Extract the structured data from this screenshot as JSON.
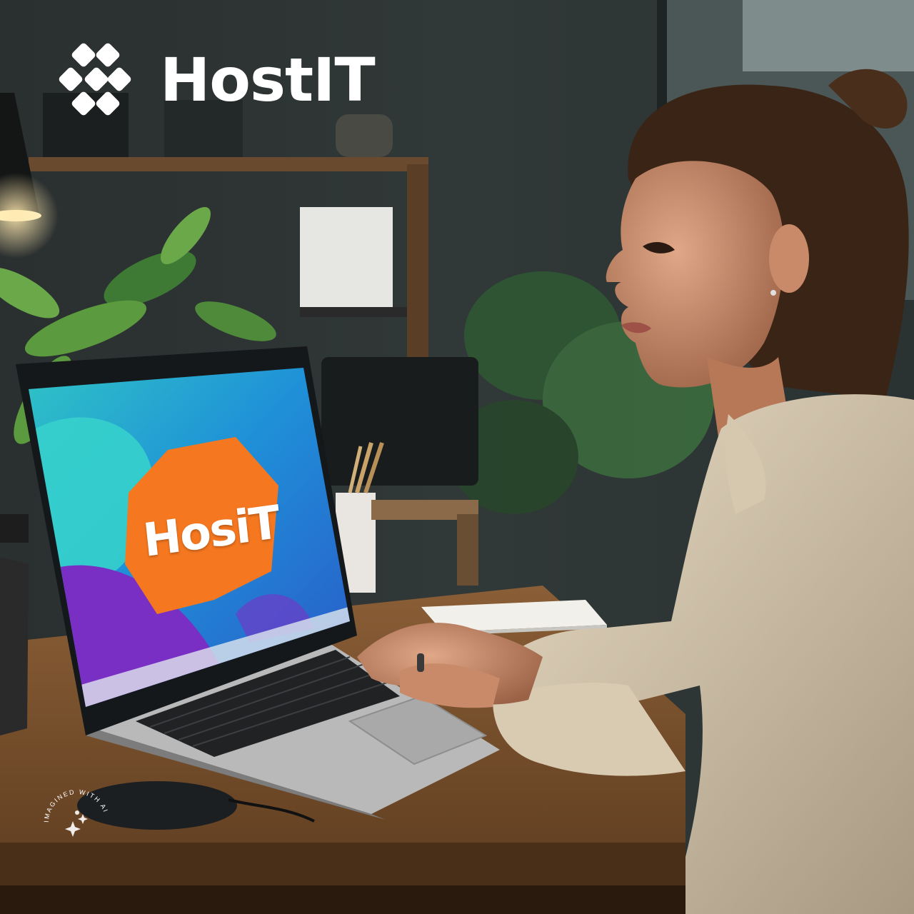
{
  "brand": {
    "name": "HostIT",
    "logo_icon": "hostit-logo-icon"
  },
  "laptop_screen": {
    "logo_text": "HosiT",
    "colors": {
      "teal": "#2fc3c6",
      "blue": "#1f7fd8",
      "purple": "#7a2fc4",
      "orange": "#f5771f"
    }
  },
  "watermark": {
    "text": "IMAGINED WITH AI",
    "icon": "sparkle-icon"
  }
}
